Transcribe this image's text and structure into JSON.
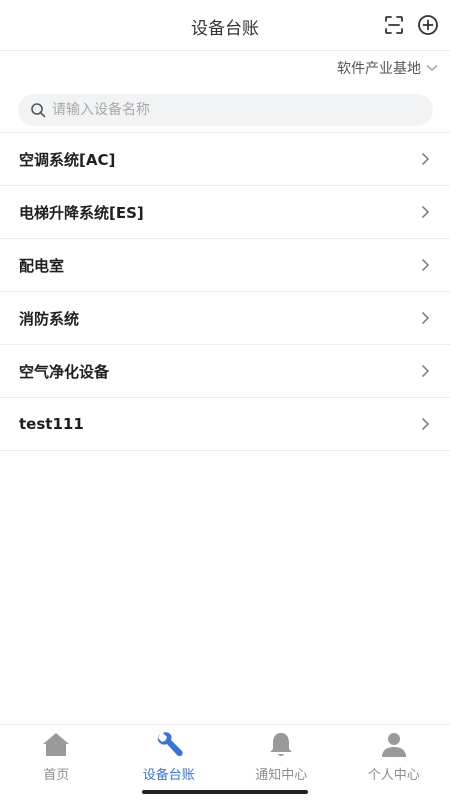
{
  "header": {
    "title": "设备台账",
    "scan_icon": "scan-icon",
    "add_icon": "add-circle-icon"
  },
  "location": {
    "selected": "软件产业基地"
  },
  "search": {
    "placeholder": "请输入设备名称",
    "value": ""
  },
  "equipment_list": [
    {
      "label": "空调系统[AC]"
    },
    {
      "label": "电梯升降系统[ES]"
    },
    {
      "label": "配电室"
    },
    {
      "label": "消防系统"
    },
    {
      "label": "空气净化设备"
    },
    {
      "label": "test111"
    }
  ],
  "tabbar": {
    "tabs": [
      {
        "label": "首页",
        "icon": "home-icon",
        "active": false
      },
      {
        "label": "设备台账",
        "icon": "wrench-icon",
        "active": true
      },
      {
        "label": "通知中心",
        "icon": "bell-icon",
        "active": false
      },
      {
        "label": "个人中心",
        "icon": "person-icon",
        "active": false
      }
    ]
  },
  "colors": {
    "accent": "#3a72d8",
    "inactive": "#8c8c8c",
    "divider": "#eeeeee",
    "search_bg": "#f2f3f5"
  }
}
